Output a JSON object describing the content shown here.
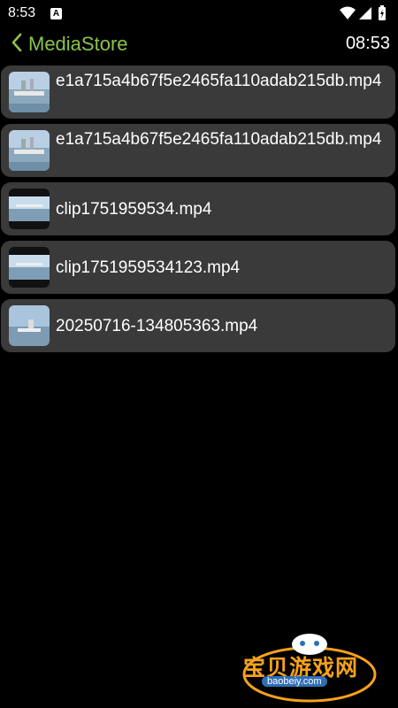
{
  "status_bar": {
    "time": "8:53",
    "notification_icon": "a-icon",
    "wifi_icon": "wifi-icon",
    "signal_icon": "signal-icon",
    "battery_icon": "battery-charging-icon"
  },
  "app_bar": {
    "back_icon": "chevron-left-icon",
    "title": "MediaStore",
    "clock": "08:53",
    "title_color": "#8bc34a"
  },
  "files": [
    {
      "name": "e1a715a4b67f5e2465fa110adab215db.mp4"
    },
    {
      "name": "e1a715a4b67f5e2465fa110adab215db.mp4"
    },
    {
      "name": "clip1751959534.mp4"
    },
    {
      "name": "clip1751959534123.mp4"
    },
    {
      "name": "20250716-134805363.mp4"
    }
  ],
  "watermark": {
    "title": "宝贝游戏网",
    "url": "baobeiy.com"
  }
}
